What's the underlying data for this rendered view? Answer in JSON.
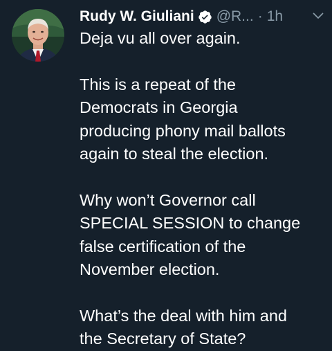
{
  "tweet": {
    "author": {
      "display_name": "Rudy W. Giuliani",
      "handle": "@R...",
      "verified": true,
      "avatar_icon": "user-avatar-photo"
    },
    "separator": "·",
    "timestamp": "1h",
    "menu_icon": "chevron-down-icon",
    "body": {
      "paragraphs": [
        {
          "lines": [
            "Deja vu all over again."
          ]
        },
        {
          "lines": [
            "This is a repeat of the",
            "Democrats in Georgia",
            "producing phony mail ballots",
            "again to steal the election."
          ]
        },
        {
          "lines": [
            "Why won’t Governor call",
            "SPECIAL SESSION to change",
            "false certification of the",
            "November election."
          ]
        },
        {
          "lines": [
            "What’s the deal with him and",
            "the Secretary of State?"
          ]
        }
      ]
    }
  },
  "colors": {
    "background": "#15202b",
    "text_primary": "#ffffff",
    "text_secondary": "#8899a6",
    "verified_badge": "#ffffff"
  }
}
